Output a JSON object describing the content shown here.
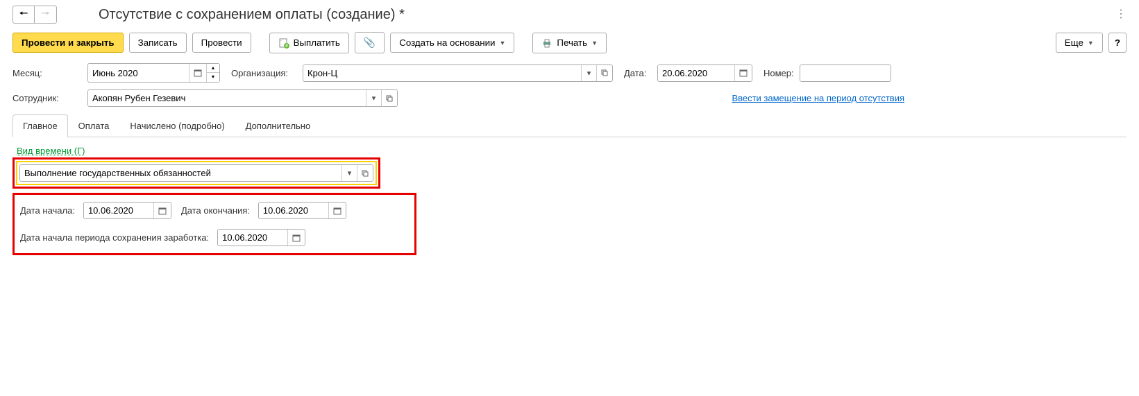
{
  "header": {
    "title": "Отсутствие с сохранением оплаты (создание) *"
  },
  "toolbar": {
    "post_and_close": "Провести и закрыть",
    "write": "Записать",
    "post": "Провести",
    "pay": "Выплатить",
    "create_based_on": "Создать на основании",
    "print": "Печать",
    "more": "Еще"
  },
  "fields": {
    "month_label": "Месяц:",
    "month_value": "Июнь 2020",
    "org_label": "Организация:",
    "org_value": "Крон-Ц",
    "date_label": "Дата:",
    "date_value": "20.06.2020",
    "number_label": "Номер:",
    "number_value": "",
    "employee_label": "Сотрудник:",
    "employee_value": "Акопян Рубен Гезевич",
    "substitution_link": "Ввести замещение на период отсутствия"
  },
  "tabs": {
    "main": "Главное",
    "payment": "Оплата",
    "accrued": "Начислено (подробно)",
    "additional": "Дополнительно"
  },
  "main_tab": {
    "time_type_label": "Вид времени (Г)",
    "time_type_value": "Выполнение государственных обязанностей",
    "start_date_label": "Дата начала:",
    "start_date_value": "10.06.2020",
    "end_date_label": "Дата окончания:",
    "end_date_value": "10.06.2020",
    "salary_period_start_label": "Дата начала периода сохранения заработка:",
    "salary_period_start_value": "10.06.2020"
  }
}
